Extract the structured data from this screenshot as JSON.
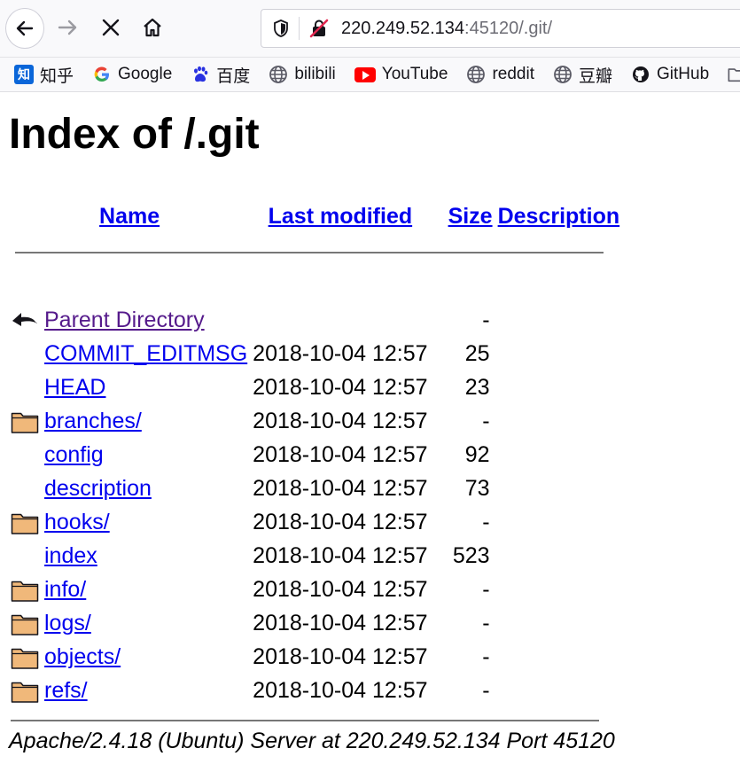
{
  "browser": {
    "url_host": "220.249.52.134",
    "url_rest": ":45120/.git/"
  },
  "bookmarks": [
    {
      "label": "知乎",
      "icon": "zhihu-icon"
    },
    {
      "label": "Google",
      "icon": "google-icon"
    },
    {
      "label": "百度",
      "icon": "baidu-icon"
    },
    {
      "label": "bilibili",
      "icon": "globe-icon"
    },
    {
      "label": "YouTube",
      "icon": "youtube-icon"
    },
    {
      "label": "reddit",
      "icon": "globe-icon"
    },
    {
      "label": "豆瓣",
      "icon": "globe-icon"
    },
    {
      "label": "GitHub",
      "icon": "github-icon"
    },
    {
      "label": "",
      "icon": "folder-icon"
    }
  ],
  "page": {
    "title": "Index of /.git",
    "columns": {
      "name": "Name",
      "last_modified": "Last modified",
      "size": "Size",
      "description": "Description"
    },
    "parent": {
      "name": "Parent Directory",
      "date": "",
      "size": "-"
    },
    "rows": [
      {
        "name": "COMMIT_EDITMSG",
        "date": "2018-10-04 12:57",
        "size": "25",
        "icon": "blank"
      },
      {
        "name": "HEAD",
        "date": "2018-10-04 12:57",
        "size": "23",
        "icon": "blank"
      },
      {
        "name": "branches/",
        "date": "2018-10-04 12:57",
        "size": "-",
        "icon": "folder-icon"
      },
      {
        "name": "config",
        "date": "2018-10-04 12:57",
        "size": "92",
        "icon": "blank"
      },
      {
        "name": "description",
        "date": "2018-10-04 12:57",
        "size": "73",
        "icon": "blank"
      },
      {
        "name": "hooks/",
        "date": "2018-10-04 12:57",
        "size": "-",
        "icon": "folder-icon"
      },
      {
        "name": "index",
        "date": "2018-10-04 12:57",
        "size": "523",
        "icon": "blank"
      },
      {
        "name": "info/",
        "date": "2018-10-04 12:57",
        "size": "-",
        "icon": "folder-icon"
      },
      {
        "name": "logs/",
        "date": "2018-10-04 12:57",
        "size": "-",
        "icon": "folder-icon"
      },
      {
        "name": "objects/",
        "date": "2018-10-04 12:57",
        "size": "-",
        "icon": "folder-icon"
      },
      {
        "name": "refs/",
        "date": "2018-10-04 12:57",
        "size": "-",
        "icon": "folder-icon"
      }
    ],
    "footer": "Apache/2.4.18 (Ubuntu) Server at 220.249.52.134 Port 45120"
  },
  "colors": {
    "link": "#0000ee",
    "visited_link": "#551a8b",
    "folder_fill": "#f0b87a"
  }
}
